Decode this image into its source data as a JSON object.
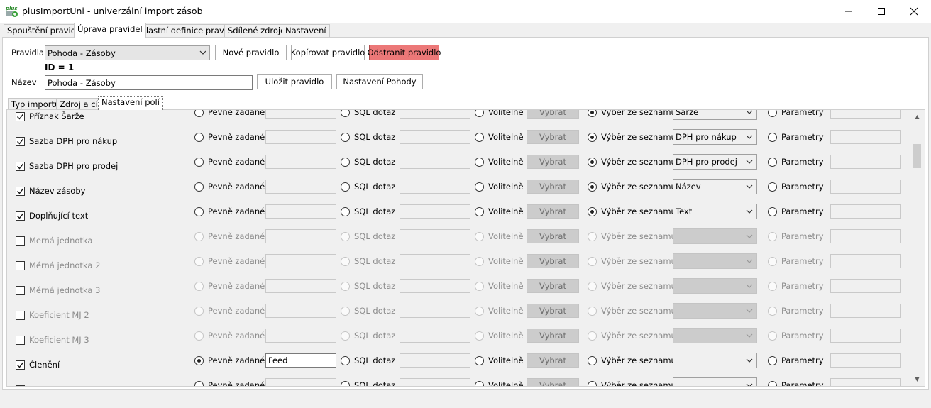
{
  "window": {
    "title": "plusImportUni - univerzální import zásob",
    "icon_text": "plus",
    "controls": {
      "minimize": "—",
      "maximize": "☐",
      "close": "✕"
    }
  },
  "main_tabs": [
    "Spouštění pravidel",
    "Úprava pravidel",
    "Vlastní definice pravidel",
    "Sdílené zdroje",
    "Nastavení"
  ],
  "rule_editor": {
    "rules_label": "Pravidla",
    "selected_rule": "Pohoda - Zásoby",
    "new_rule_button": "Nové pravidlo",
    "copy_rule_button": "Kopírovat pravidlo",
    "delete_rule_button": "Odstranit pravidlo",
    "id_text": "ID = 1",
    "name_label": "Název",
    "name_value": "Pohoda - Zásoby",
    "save_rule_button": "Uložit pravidlo",
    "pohoda_settings_button": "Nastavení Pohody",
    "delete_button_color": "#ec7878"
  },
  "inner_tabs": [
    "Typ importu",
    "Zdroj a cíl",
    "Nastavení polí"
  ],
  "options": {
    "fixed": "Pevně zadané",
    "sql": "SQL dotaz",
    "optional": "Volitelně",
    "choose_button": "Vybrat",
    "from_list": "Výběr ze seznamu",
    "params": "Parametry"
  },
  "field_rows": [
    {
      "name": "Příznak Šarže",
      "checked": true,
      "enabled": true,
      "selected": "list",
      "fixed_value": "",
      "list_value": "Šarže"
    },
    {
      "name": "Sazba DPH pro nákup",
      "checked": true,
      "enabled": true,
      "selected": "list",
      "fixed_value": "",
      "list_value": "DPH pro nákup"
    },
    {
      "name": "Sazba DPH pro prodej",
      "checked": true,
      "enabled": true,
      "selected": "list",
      "fixed_value": "",
      "list_value": "DPH pro prodej"
    },
    {
      "name": "Název zásoby",
      "checked": true,
      "enabled": true,
      "selected": "list",
      "fixed_value": "",
      "list_value": "Název"
    },
    {
      "name": "Doplňující text",
      "checked": true,
      "enabled": true,
      "selected": "list",
      "fixed_value": "",
      "list_value": "Text"
    },
    {
      "name": "Merná jednotka",
      "checked": false,
      "enabled": false,
      "selected": "",
      "fixed_value": "",
      "list_value": ""
    },
    {
      "name": "Měrná jednotka 2",
      "checked": false,
      "enabled": false,
      "selected": "",
      "fixed_value": "",
      "list_value": ""
    },
    {
      "name": "Měrná jednotka 3",
      "checked": false,
      "enabled": false,
      "selected": "",
      "fixed_value": "",
      "list_value": ""
    },
    {
      "name": "Koeficient MJ 2",
      "checked": false,
      "enabled": false,
      "selected": "",
      "fixed_value": "",
      "list_value": ""
    },
    {
      "name": "Koeficient MJ 3",
      "checked": false,
      "enabled": false,
      "selected": "",
      "fixed_value": "",
      "list_value": ""
    },
    {
      "name": "Členění",
      "checked": true,
      "enabled": true,
      "selected": "fixed",
      "fixed_value": "Feed",
      "list_value": ""
    },
    {
      "name": "",
      "checked": false,
      "enabled": true,
      "selected": "",
      "fixed_value": "",
      "list_value": ""
    }
  ],
  "scroll": {
    "up": "▲",
    "down": "▼"
  }
}
